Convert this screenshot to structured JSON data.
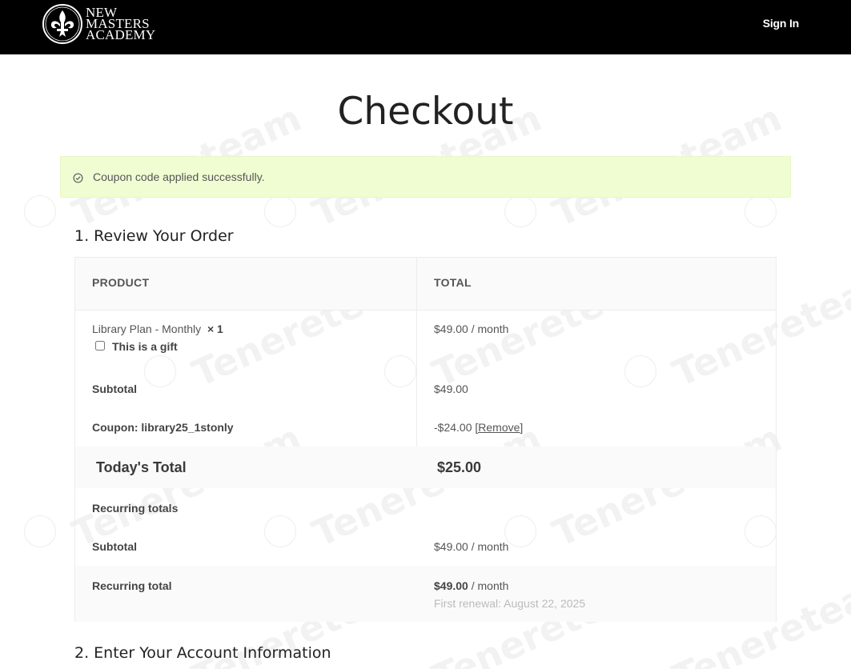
{
  "header": {
    "logo_lines": [
      "NEW",
      "MASTERS",
      "ACADEMY"
    ],
    "signin_label": "Sign In"
  },
  "page": {
    "title": "Checkout"
  },
  "notice": {
    "text": "Coupon code applied successfully."
  },
  "sections": {
    "review": "1. Review Your Order",
    "account": "2. Enter Your Account Information"
  },
  "order": {
    "col_product": "PRODUCT",
    "col_total": "TOTAL",
    "item": {
      "name": "Library Plan - Monthly",
      "qty": "× 1",
      "price": "$49.00 / month",
      "gift_label": "This is a gift"
    },
    "subtotal": {
      "label": "Subtotal",
      "value": "$49.00"
    },
    "coupon": {
      "label": "Coupon: library25_1stonly",
      "value": "-$24.00",
      "remove_label": "[Remove]"
    },
    "today_total": {
      "label": "Today's Total",
      "value": "$25.00"
    },
    "recurring_heading": "Recurring totals",
    "recurring_subtotal": {
      "label": "Subtotal",
      "value": "$49.00 / month"
    },
    "recurring_total": {
      "label": "Recurring total",
      "amount": "$49.00",
      "period": "/ month",
      "renewal": "First renewal: August 22, 2025"
    }
  },
  "watermark": {
    "text": "Tenereteam"
  }
}
